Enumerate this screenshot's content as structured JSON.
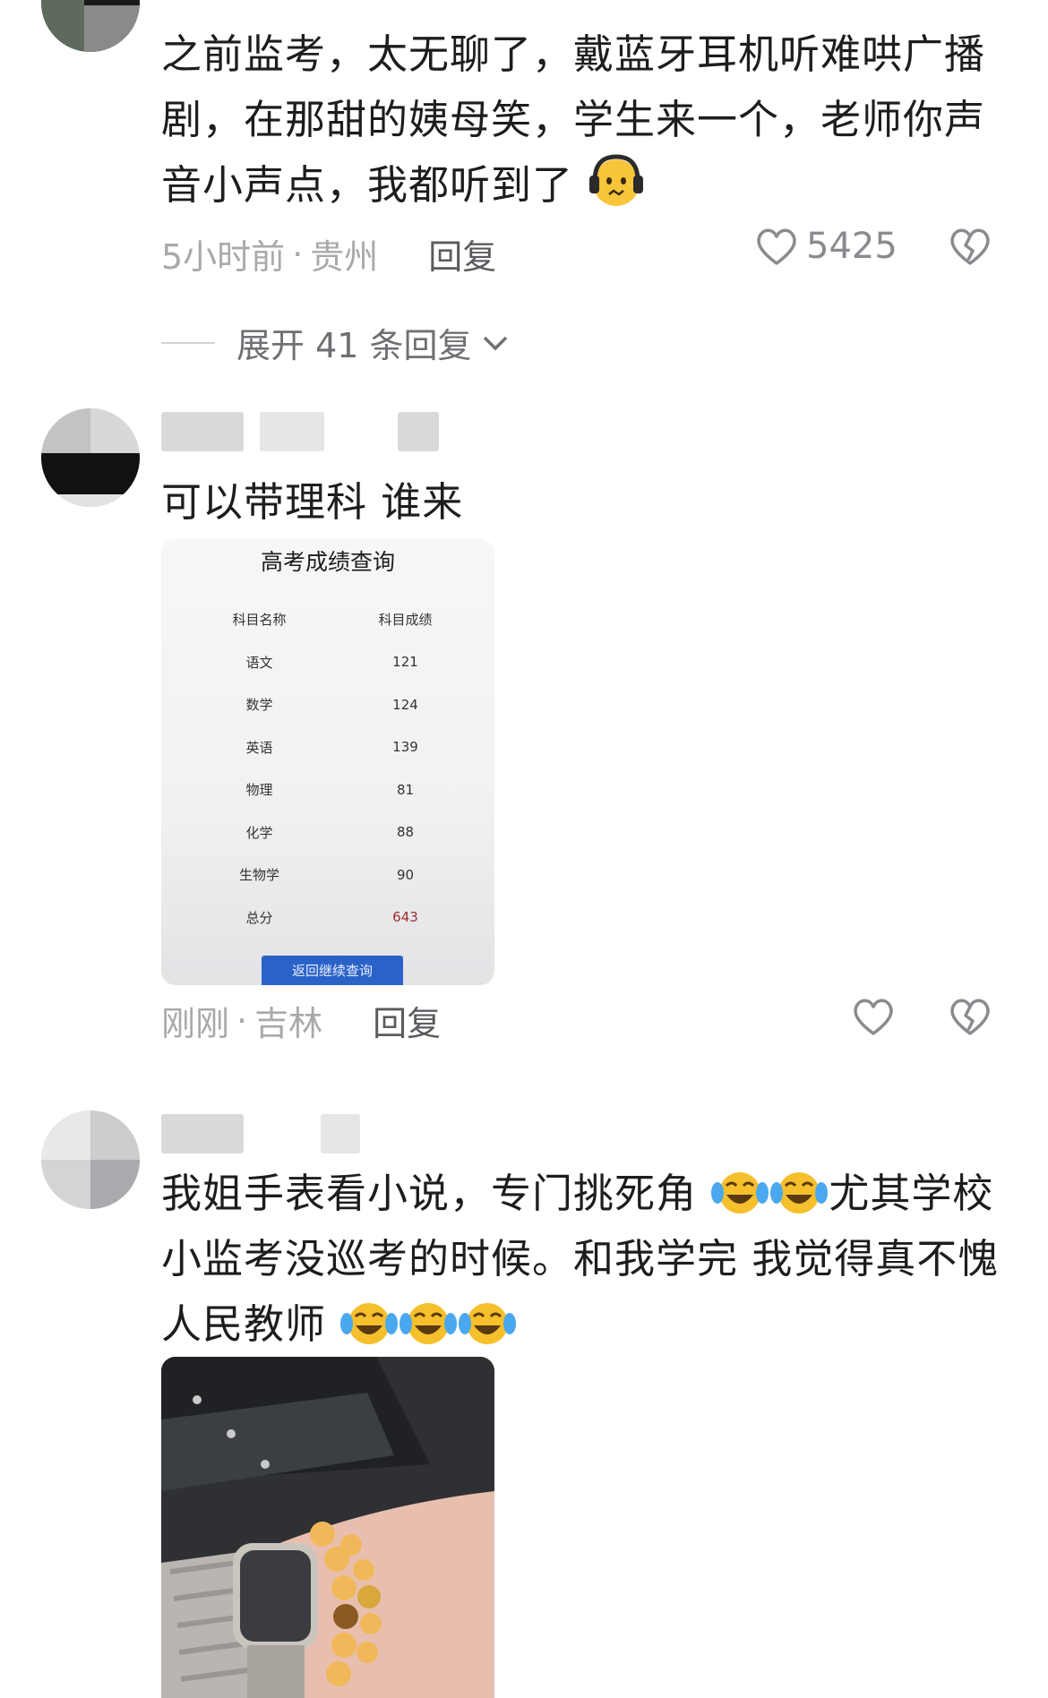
{
  "comments": [
    {
      "text_lines": [
        "之前监考，太无聊了，戴蓝牙耳机听难哄广播",
        "剧，在那甜的姨母笑，学生来一个，老师你声",
        "音小声点，我都听到了"
      ],
      "time": "5小时前",
      "location": "贵州",
      "reply_label": "回复",
      "like_count": "5425"
    },
    {
      "text": "可以带理科 谁来",
      "time": "刚刚",
      "location": "吉林",
      "reply_label": "回复",
      "like_count": ""
    },
    {
      "text_lines": [
        "我姐手表看小说，专门挑死角",
        "小监考没巡考的时候。和我学完 我觉得真不愧",
        "人民教师"
      ]
    }
  ],
  "expand": {
    "label": "展开 41 条回复"
  },
  "meta_separator": "·",
  "score_card": {
    "title": "高考成绩查询",
    "header": [
      "科目名称",
      "科目成绩"
    ],
    "rows": [
      [
        "语文",
        "121"
      ],
      [
        "数学",
        "124"
      ],
      [
        "英语",
        "139"
      ],
      [
        "物理",
        "81"
      ],
      [
        "化学",
        "88"
      ],
      [
        "生物学",
        "90"
      ],
      [
        "总分",
        "643"
      ]
    ],
    "button": "返回继续查询"
  },
  "colors": {
    "meta": "#a9a9ad",
    "reply": "#5b5b60",
    "total": "#9a2d2d",
    "button": "#2a62c8"
  },
  "icons": [
    "heart-outline-icon",
    "broken-heart-icon",
    "chevron-down-icon",
    "headphones-emoji-icon",
    "tears-of-joy-emoji-icon"
  ]
}
